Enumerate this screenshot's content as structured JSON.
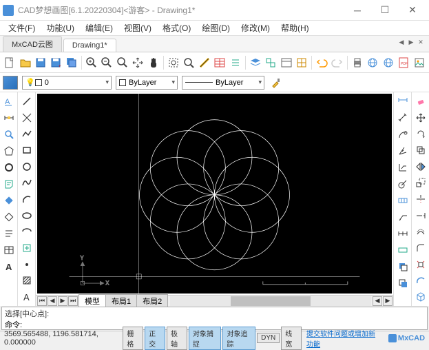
{
  "title": "CAD梦想画图[6.1.20220304]<游客> - Drawing1*",
  "menu": [
    "文件(F)",
    "功能(U)",
    "编辑(E)",
    "视图(V)",
    "格式(O)",
    "绘图(D)",
    "修改(M)",
    "帮助(H)"
  ],
  "tabs": {
    "items": [
      "MxCAD云图",
      "Drawing1*"
    ],
    "active": 1
  },
  "props": {
    "layer": "0",
    "color": "ByLayer",
    "linetype": "ByLayer"
  },
  "layoutTabs": [
    "模型",
    "布局1",
    "布局2"
  ],
  "cmd": {
    "prompt": "选择[中心点]:",
    "input": "命令:"
  },
  "coords": "3569.565488, 1196.581714, 0.000000",
  "status": {
    "buttons": [
      {
        "label": "栅格",
        "on": false
      },
      {
        "label": "正交",
        "on": true
      },
      {
        "label": "极轴",
        "on": false
      },
      {
        "label": "对象捕捉",
        "on": true
      },
      {
        "label": "对象追踪",
        "on": true
      },
      {
        "label": "DYN",
        "on": false
      },
      {
        "label": "线宽",
        "on": false
      }
    ],
    "link": "提交软件问题或增加新功能",
    "brand": "MxCAD"
  }
}
